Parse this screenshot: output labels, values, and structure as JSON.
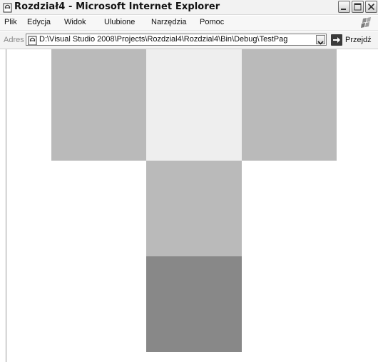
{
  "window": {
    "title": "Rozdział4 - Microsoft Internet Explorer"
  },
  "menu": {
    "items": [
      {
        "label": "Plik"
      },
      {
        "label": "Edycja"
      },
      {
        "label": "Widok"
      },
      {
        "label": "Ulubione"
      },
      {
        "label": "Narzędzia"
      },
      {
        "label": "Pomoc"
      }
    ]
  },
  "address": {
    "label": "Adres",
    "url": "D:\\Visual Studio 2008\\Projects\\Rozdzial4\\Rozdzial4\\Bin\\Debug\\TestPag",
    "go_label": "Przejdź"
  },
  "tiles": [
    {
      "color": "#bababa"
    },
    {
      "color": "#eeeeee"
    },
    {
      "color": "#bababa"
    },
    {
      "color": "#bababa"
    },
    {
      "color": "#888888"
    }
  ],
  "icons": {
    "title": "ie-page-icon",
    "minimize": "minimize-icon",
    "maximize": "maximize-icon",
    "close": "close-icon",
    "windows_logo": "windows-logo-icon",
    "address_page": "ie-page-icon",
    "dropdown": "chevron-down-icon",
    "go": "arrow-right-icon"
  }
}
